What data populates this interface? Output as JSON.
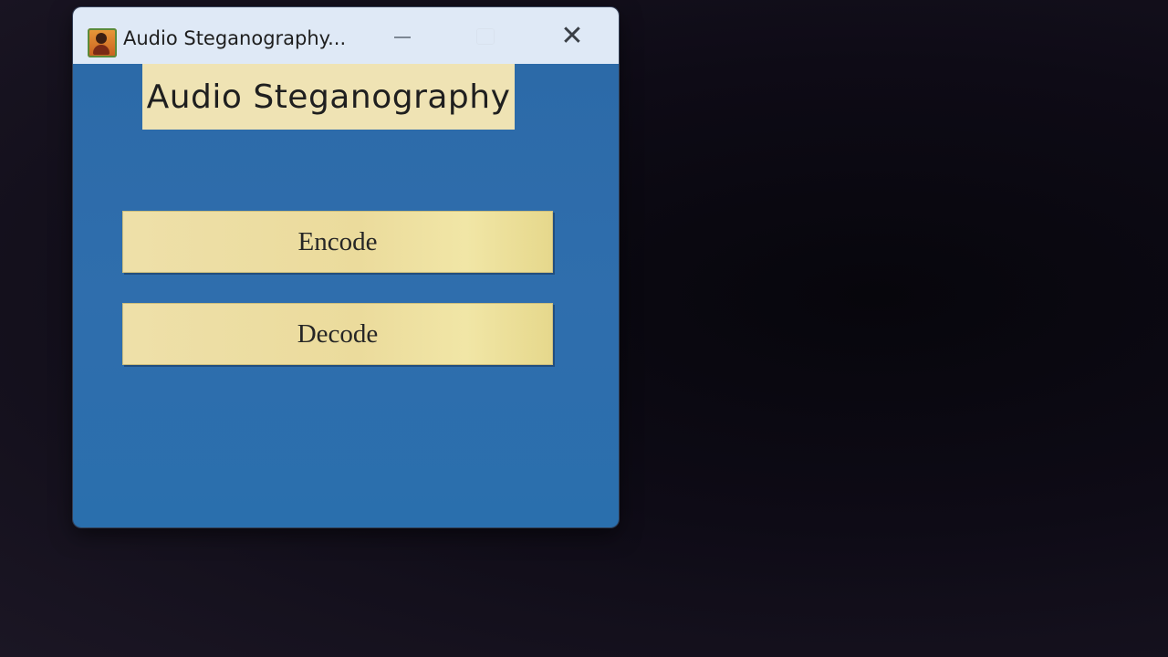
{
  "window": {
    "title": "Audio Steganography...",
    "icon": "app-person-icon",
    "controls": {
      "minimize_icon": "minimize-icon",
      "maximize_icon": "maximize-icon",
      "close_label": "✕",
      "close_icon": "close-icon"
    }
  },
  "main": {
    "heading": "Audio Steganography",
    "buttons": [
      {
        "label": "Encode"
      },
      {
        "label": "Decode"
      }
    ]
  },
  "colors": {
    "client_background": "#2c6aa8",
    "button_background": "#ebdb9c",
    "heading_background": "#efe3b4",
    "titlebar": "#dfe9f6"
  }
}
